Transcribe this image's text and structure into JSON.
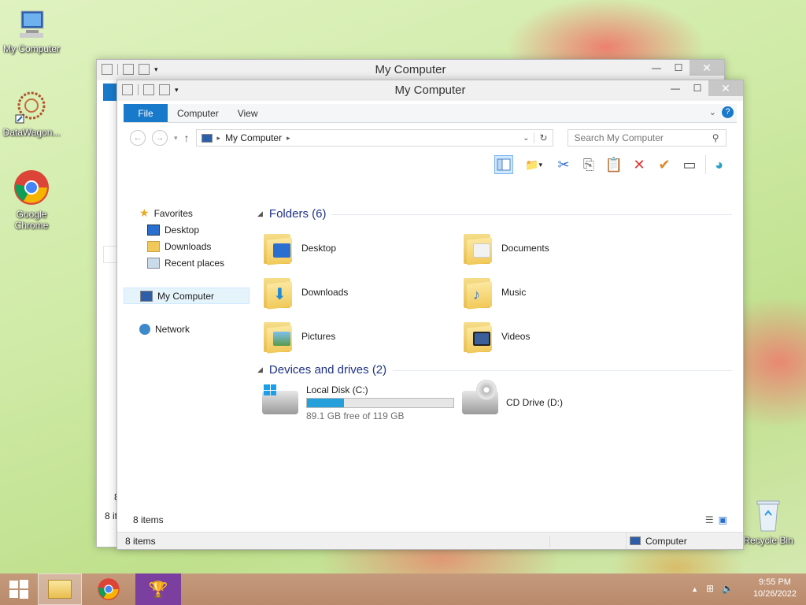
{
  "desktop": {
    "icons": [
      {
        "label": "My Computer",
        "icon": "computer-icon"
      },
      {
        "label": "DataWagon...",
        "icon": "datawagon-icon"
      },
      {
        "label": "Google Chrome",
        "icon": "chrome-icon"
      },
      {
        "label": "Recycle Bin",
        "icon": "recycle-bin-icon"
      }
    ]
  },
  "back_window": {
    "title": "My Computer",
    "status_left": "8 it",
    "status_small": "8"
  },
  "window": {
    "title": "My Computer",
    "tabs": [
      "File",
      "Computer",
      "View"
    ],
    "address": "My Computer",
    "search_placeholder": "Search My Computer",
    "nav": {
      "favorites": "Favorites",
      "favorites_items": [
        "Desktop",
        "Downloads",
        "Recent places"
      ],
      "computer": "My Computer",
      "network": "Network"
    },
    "folders_header": "Folders (6)",
    "folders": [
      {
        "name": "Desktop",
        "icon": "desktop-folder-icon",
        "badge_color": "#2a6fd0"
      },
      {
        "name": "Documents",
        "icon": "documents-folder-icon",
        "badge_color": "#f2f2f2"
      },
      {
        "name": "Downloads",
        "icon": "downloads-folder-icon",
        "badge_color": "#1f8ad8"
      },
      {
        "name": "Music",
        "icon": "music-folder-icon",
        "badge_color": "#3b7dd8"
      },
      {
        "name": "Pictures",
        "icon": "pictures-folder-icon",
        "badge_color": "#5aa0e0"
      },
      {
        "name": "Videos",
        "icon": "videos-folder-icon",
        "badge_color": "#3a5f9a"
      }
    ],
    "drives_header": "Devices and drives (2)",
    "drives": [
      {
        "name": "Local Disk (C:)",
        "free": "89.1 GB free of 119 GB",
        "used_fraction": 0.25,
        "icon": "local-disk-icon"
      },
      {
        "name": "CD Drive (D:)",
        "icon": "cd-drive-icon"
      }
    ],
    "status_items": "8 items",
    "outer_status_items": "8 items",
    "outer_status_location": "Computer"
  },
  "taskbar": {
    "time": "9:55 PM",
    "date": "10/26/2022"
  },
  "colors": {
    "accent": "#1979ca",
    "progress": "#26a0da"
  }
}
